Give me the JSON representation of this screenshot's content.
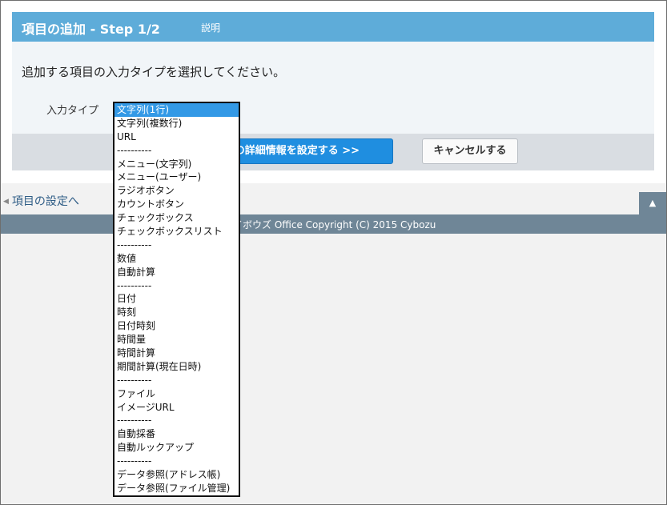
{
  "header": {
    "title": "項目の追加 - Step 1/2",
    "help_link": "説明"
  },
  "instruction": "追加する項目の入力タイプを選択してください。",
  "input_type": {
    "label": "入力タイプ",
    "options": [
      "文字列(1行)",
      "文字列(複数行)",
      "URL",
      "----------",
      "メニュー(文字列)",
      "メニュー(ユーザー)",
      "ラジオボタン",
      "カウントボタン",
      "チェックボックス",
      "チェックボックスリスト",
      "----------",
      "数値",
      "自動計算",
      "----------",
      "日付",
      "時刻",
      "日付時刻",
      "時間量",
      "時間計算",
      "期間計算(現在日時)",
      "----------",
      "ファイル",
      "イメージURL",
      "----------",
      "自動採番",
      "自動ルックアップ",
      "----------",
      "データ参照(アドレス帳)",
      "データ参照(ファイル管理)"
    ],
    "selected": "文字列(1行)"
  },
  "actions": {
    "next_label": "の詳細情報を設定する >>",
    "cancel_label": "キャンセルする"
  },
  "nav": {
    "back_label": "項目の設定へ",
    "page_top": "▲"
  },
  "footer": {
    "copyright": "イボウズ Office Copyright (C) 2015 Cybozu"
  },
  "colors": {
    "header": "#5eacd9",
    "primary_button": "#1f8ee0",
    "footer": "#6f8697",
    "selection": "#3399e6"
  }
}
